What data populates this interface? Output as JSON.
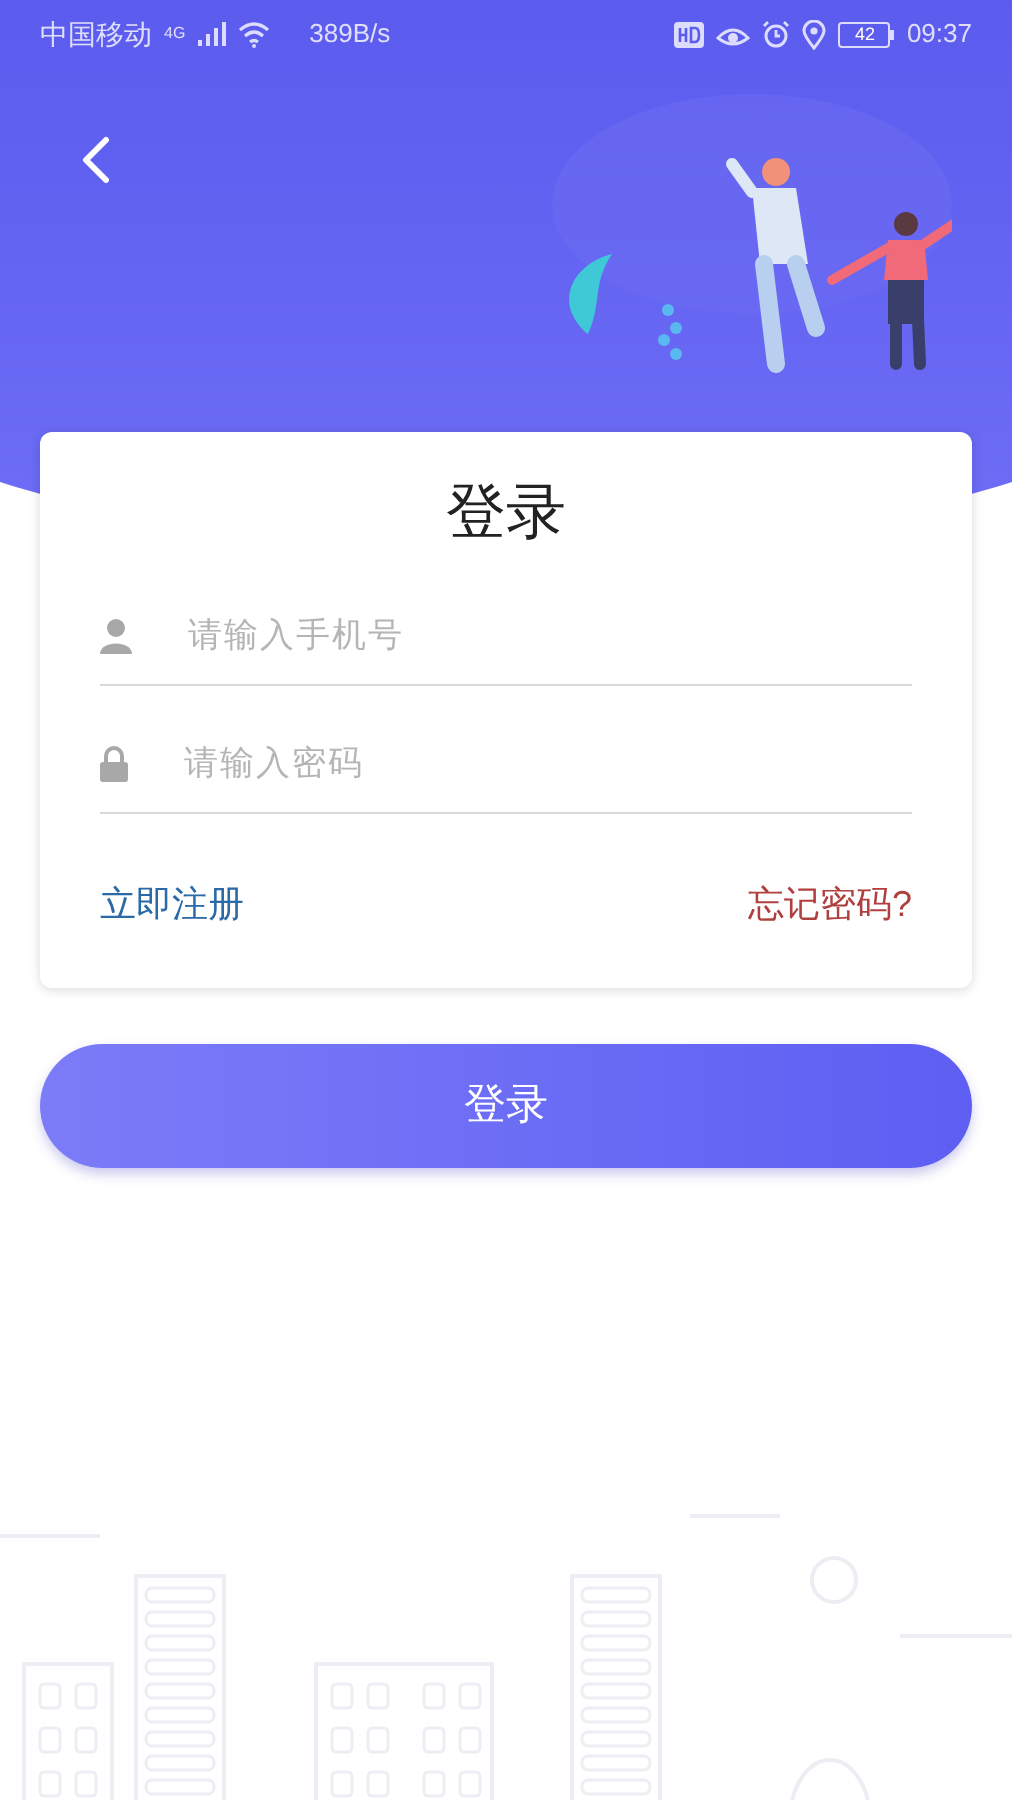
{
  "status_bar": {
    "carrier": "中国移动",
    "network": "4G",
    "speed": "389B/s",
    "battery": "42",
    "time": "09:37"
  },
  "login_card": {
    "title": "登录",
    "fields": [
      {
        "kind": "phone",
        "placeholder": "请输入手机号"
      },
      {
        "kind": "password",
        "placeholder": "请输入密码"
      }
    ],
    "register_link": "立即注册",
    "forgot_link": "忘记密码?"
  },
  "login_button": {
    "label": "登录"
  }
}
